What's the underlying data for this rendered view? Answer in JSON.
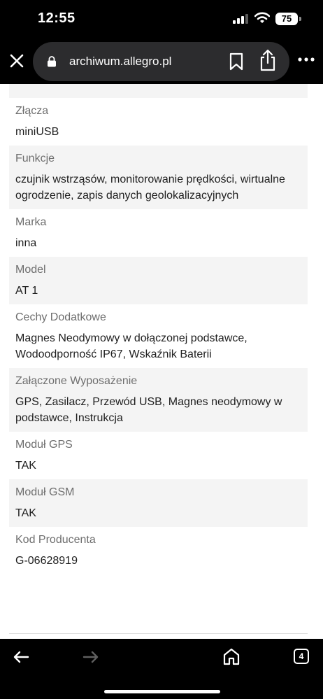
{
  "status_bar": {
    "time": "12:55",
    "battery": "75"
  },
  "browser": {
    "url": "archiwum.allegro.pl"
  },
  "rows": [
    {
      "label": "Złącza",
      "value": "miniUSB"
    },
    {
      "label": "Funkcje",
      "value": "czujnik wstrząsów, monitorowanie prędkości, wirtualne ogrodzenie, zapis danych geolokalizacyjnych"
    },
    {
      "label": "Marka",
      "value": "inna"
    },
    {
      "label": "Model",
      "value": "AT 1"
    },
    {
      "label": "Cechy Dodatkowe",
      "value": "Magnes Neodymowy w dołączonej podstawce, Wodoodporność IP67, Wskaźnik Baterii"
    },
    {
      "label": "Załączone Wyposażenie",
      "value": "GPS, Zasilacz, Przewód USB, Magnes neodymowy w podstawce, Instrukcja"
    },
    {
      "label": "Moduł GPS",
      "value": "TAK"
    },
    {
      "label": "Moduł GSM",
      "value": "TAK"
    },
    {
      "label": "Kod Producenta",
      "value": "G-06628919"
    }
  ],
  "toolbar": {
    "tab_count": "4"
  }
}
